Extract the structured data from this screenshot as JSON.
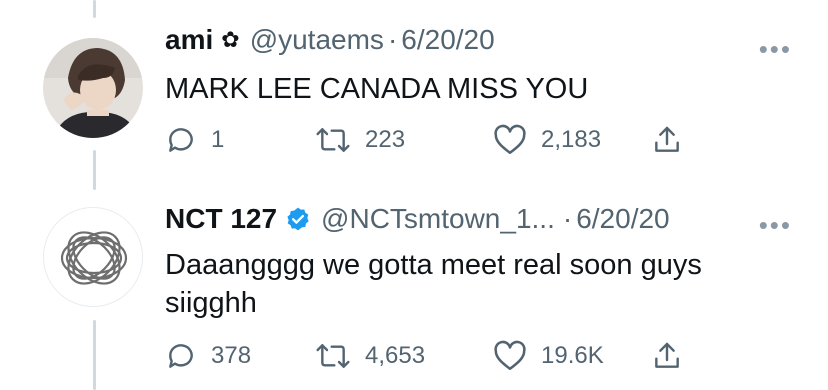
{
  "tweets": [
    {
      "display_name": "ami",
      "name_emoji": "✿",
      "handle": "@yutaems",
      "separator": "·",
      "date": "6/20/20",
      "text": "MARK LEE CANADA MISS YOU",
      "more_label": "•••",
      "replies": "1",
      "retweets": "223",
      "likes": "2,183",
      "verified": false
    },
    {
      "display_name": "NCT 127",
      "handle": "@NCTsmtown_1...",
      "separator": "·",
      "date": "6/20/20",
      "text": "Daaangggg we gotta meet real soon guys siigghh",
      "more_label": "•••",
      "replies": "378",
      "retweets": "4,653",
      "likes": "19.6K",
      "verified": true
    }
  ],
  "colors": {
    "text": "#0f1419",
    "muted": "#536471",
    "verified": "#1d9bf0",
    "thread_line": "#cfd9de"
  }
}
